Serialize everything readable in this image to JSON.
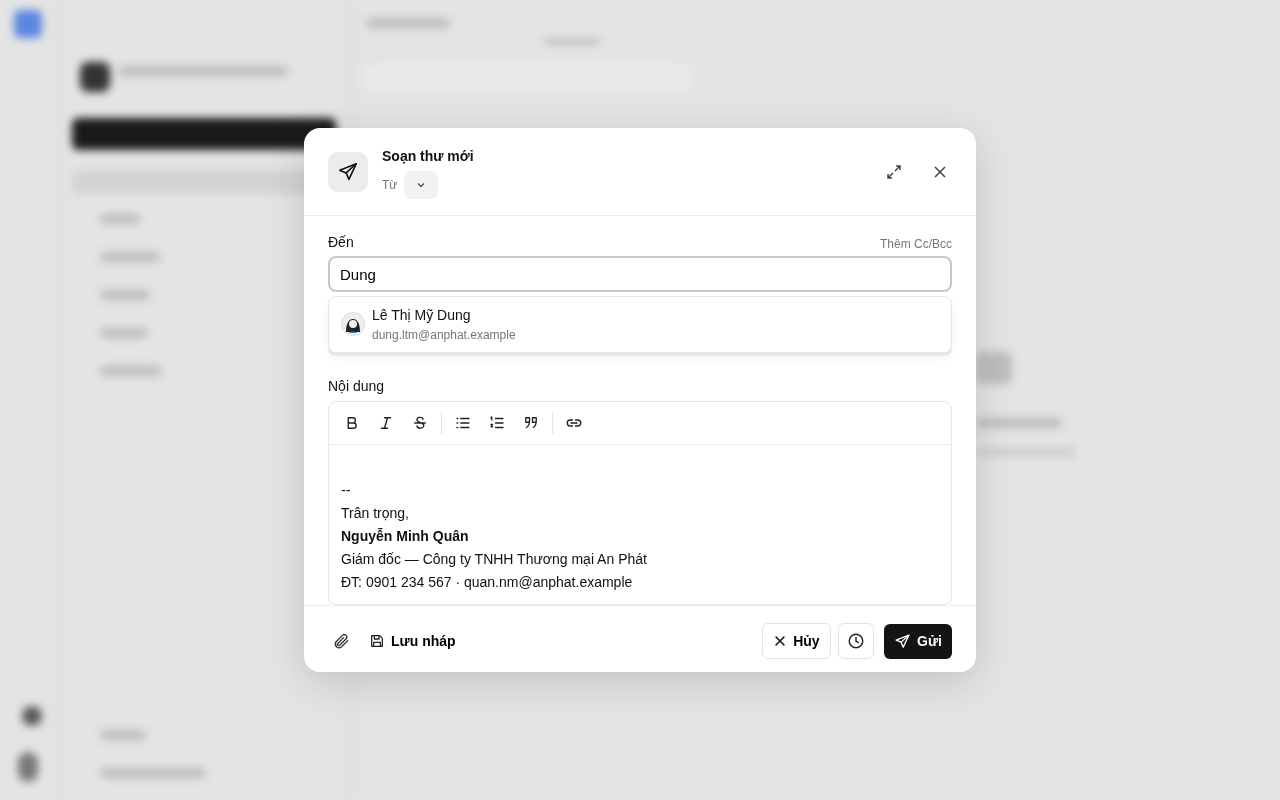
{
  "compose": {
    "title": "Soạn thư mới",
    "from_label": "Từ"
  },
  "to": {
    "label": "Đến",
    "cc_link": "Thêm Cc/Bcc",
    "value": "Dung",
    "suggestions": [
      {
        "name": "Lê Thị Mỹ Dung",
        "email": "dung.ltm@anphat.example"
      }
    ]
  },
  "body": {
    "label": "Nội dung",
    "lines": [
      {
        "text": "--",
        "bold": false
      },
      {
        "text": "Trân trọng,",
        "bold": false
      },
      {
        "text": "Nguyễn Minh Quân",
        "bold": true
      },
      {
        "text": "Giám đốc — Công ty TNHH Thương mại An Phát",
        "bold": false
      },
      {
        "text": "ĐT: 0901 234 567 · quan.nm@anphat.example",
        "bold": false
      }
    ]
  },
  "footer": {
    "save_draft": "Lưu nháp",
    "cancel": "Hủy",
    "send": "Gửi"
  }
}
